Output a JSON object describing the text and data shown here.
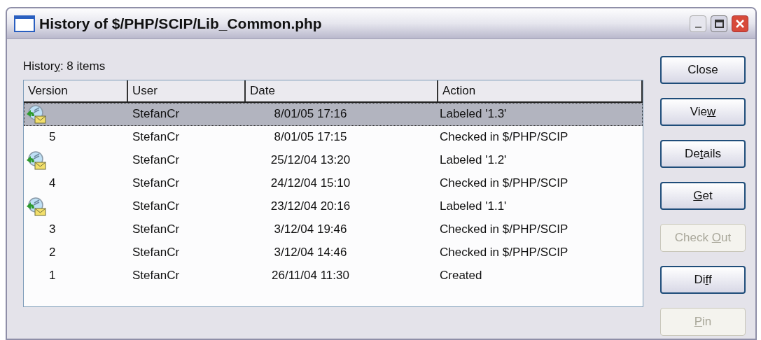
{
  "window": {
    "title": "History of $/PHP/SCIP/Lib_Common.php"
  },
  "history_label": {
    "parts": [
      {
        "text": "Histor",
        "underlined": false
      },
      {
        "text": "y",
        "underlined": true
      },
      {
        "text": ": 8 items",
        "underlined": false
      }
    ]
  },
  "table": {
    "columns": [
      "Version",
      "User",
      "Date",
      "Action"
    ],
    "rows": [
      {
        "kind": "label",
        "version": "",
        "user": "StefanCr",
        "date": "8/01/05 17:16",
        "action": "Labeled '1.3'",
        "selected": true
      },
      {
        "kind": "version",
        "version": "5",
        "user": "StefanCr",
        "date": "8/01/05 17:15",
        "action": "Checked in $/PHP/SCIP",
        "selected": false
      },
      {
        "kind": "label",
        "version": "",
        "user": "StefanCr",
        "date": "25/12/04 13:20",
        "action": "Labeled '1.2'",
        "selected": false
      },
      {
        "kind": "version",
        "version": "4",
        "user": "StefanCr",
        "date": "24/12/04 15:10",
        "action": "Checked in $/PHP/SCIP",
        "selected": false
      },
      {
        "kind": "label",
        "version": "",
        "user": "StefanCr",
        "date": "23/12/04 20:16",
        "action": "Labeled '1.1'",
        "selected": false
      },
      {
        "kind": "version",
        "version": "3",
        "user": "StefanCr",
        "date": "3/12/04 19:46",
        "action": "Checked in $/PHP/SCIP",
        "selected": false
      },
      {
        "kind": "version",
        "version": "2",
        "user": "StefanCr",
        "date": "3/12/04 14:46",
        "action": "Checked in $/PHP/SCIP",
        "selected": false
      },
      {
        "kind": "version",
        "version": "1",
        "user": "StefanCr",
        "date": "26/11/04 11:30",
        "action": "Created",
        "selected": false
      }
    ]
  },
  "buttons": [
    {
      "parts": [
        {
          "text": "Close",
          "underlined": false
        }
      ],
      "disabled": false
    },
    {
      "parts": [
        {
          "text": "Vie",
          "underlined": false
        },
        {
          "text": "w",
          "underlined": true
        }
      ],
      "disabled": false
    },
    {
      "parts": [
        {
          "text": "De",
          "underlined": false
        },
        {
          "text": "t",
          "underlined": true
        },
        {
          "text": "ails",
          "underlined": false
        }
      ],
      "disabled": false
    },
    {
      "parts": [
        {
          "text": "G",
          "underlined": true
        },
        {
          "text": "et",
          "underlined": false
        }
      ],
      "disabled": false
    },
    {
      "parts": [
        {
          "text": "Check ",
          "underlined": false
        },
        {
          "text": "O",
          "underlined": true
        },
        {
          "text": "ut",
          "underlined": false
        }
      ],
      "disabled": true
    },
    {
      "parts": [
        {
          "text": "Di",
          "underlined": false
        },
        {
          "text": "f",
          "underlined": true
        },
        {
          "text": "f",
          "underlined": false
        }
      ],
      "disabled": false
    },
    {
      "parts": [
        {
          "text": "P",
          "underlined": true
        },
        {
          "text": "in",
          "underlined": false
        }
      ],
      "disabled": true
    }
  ]
}
